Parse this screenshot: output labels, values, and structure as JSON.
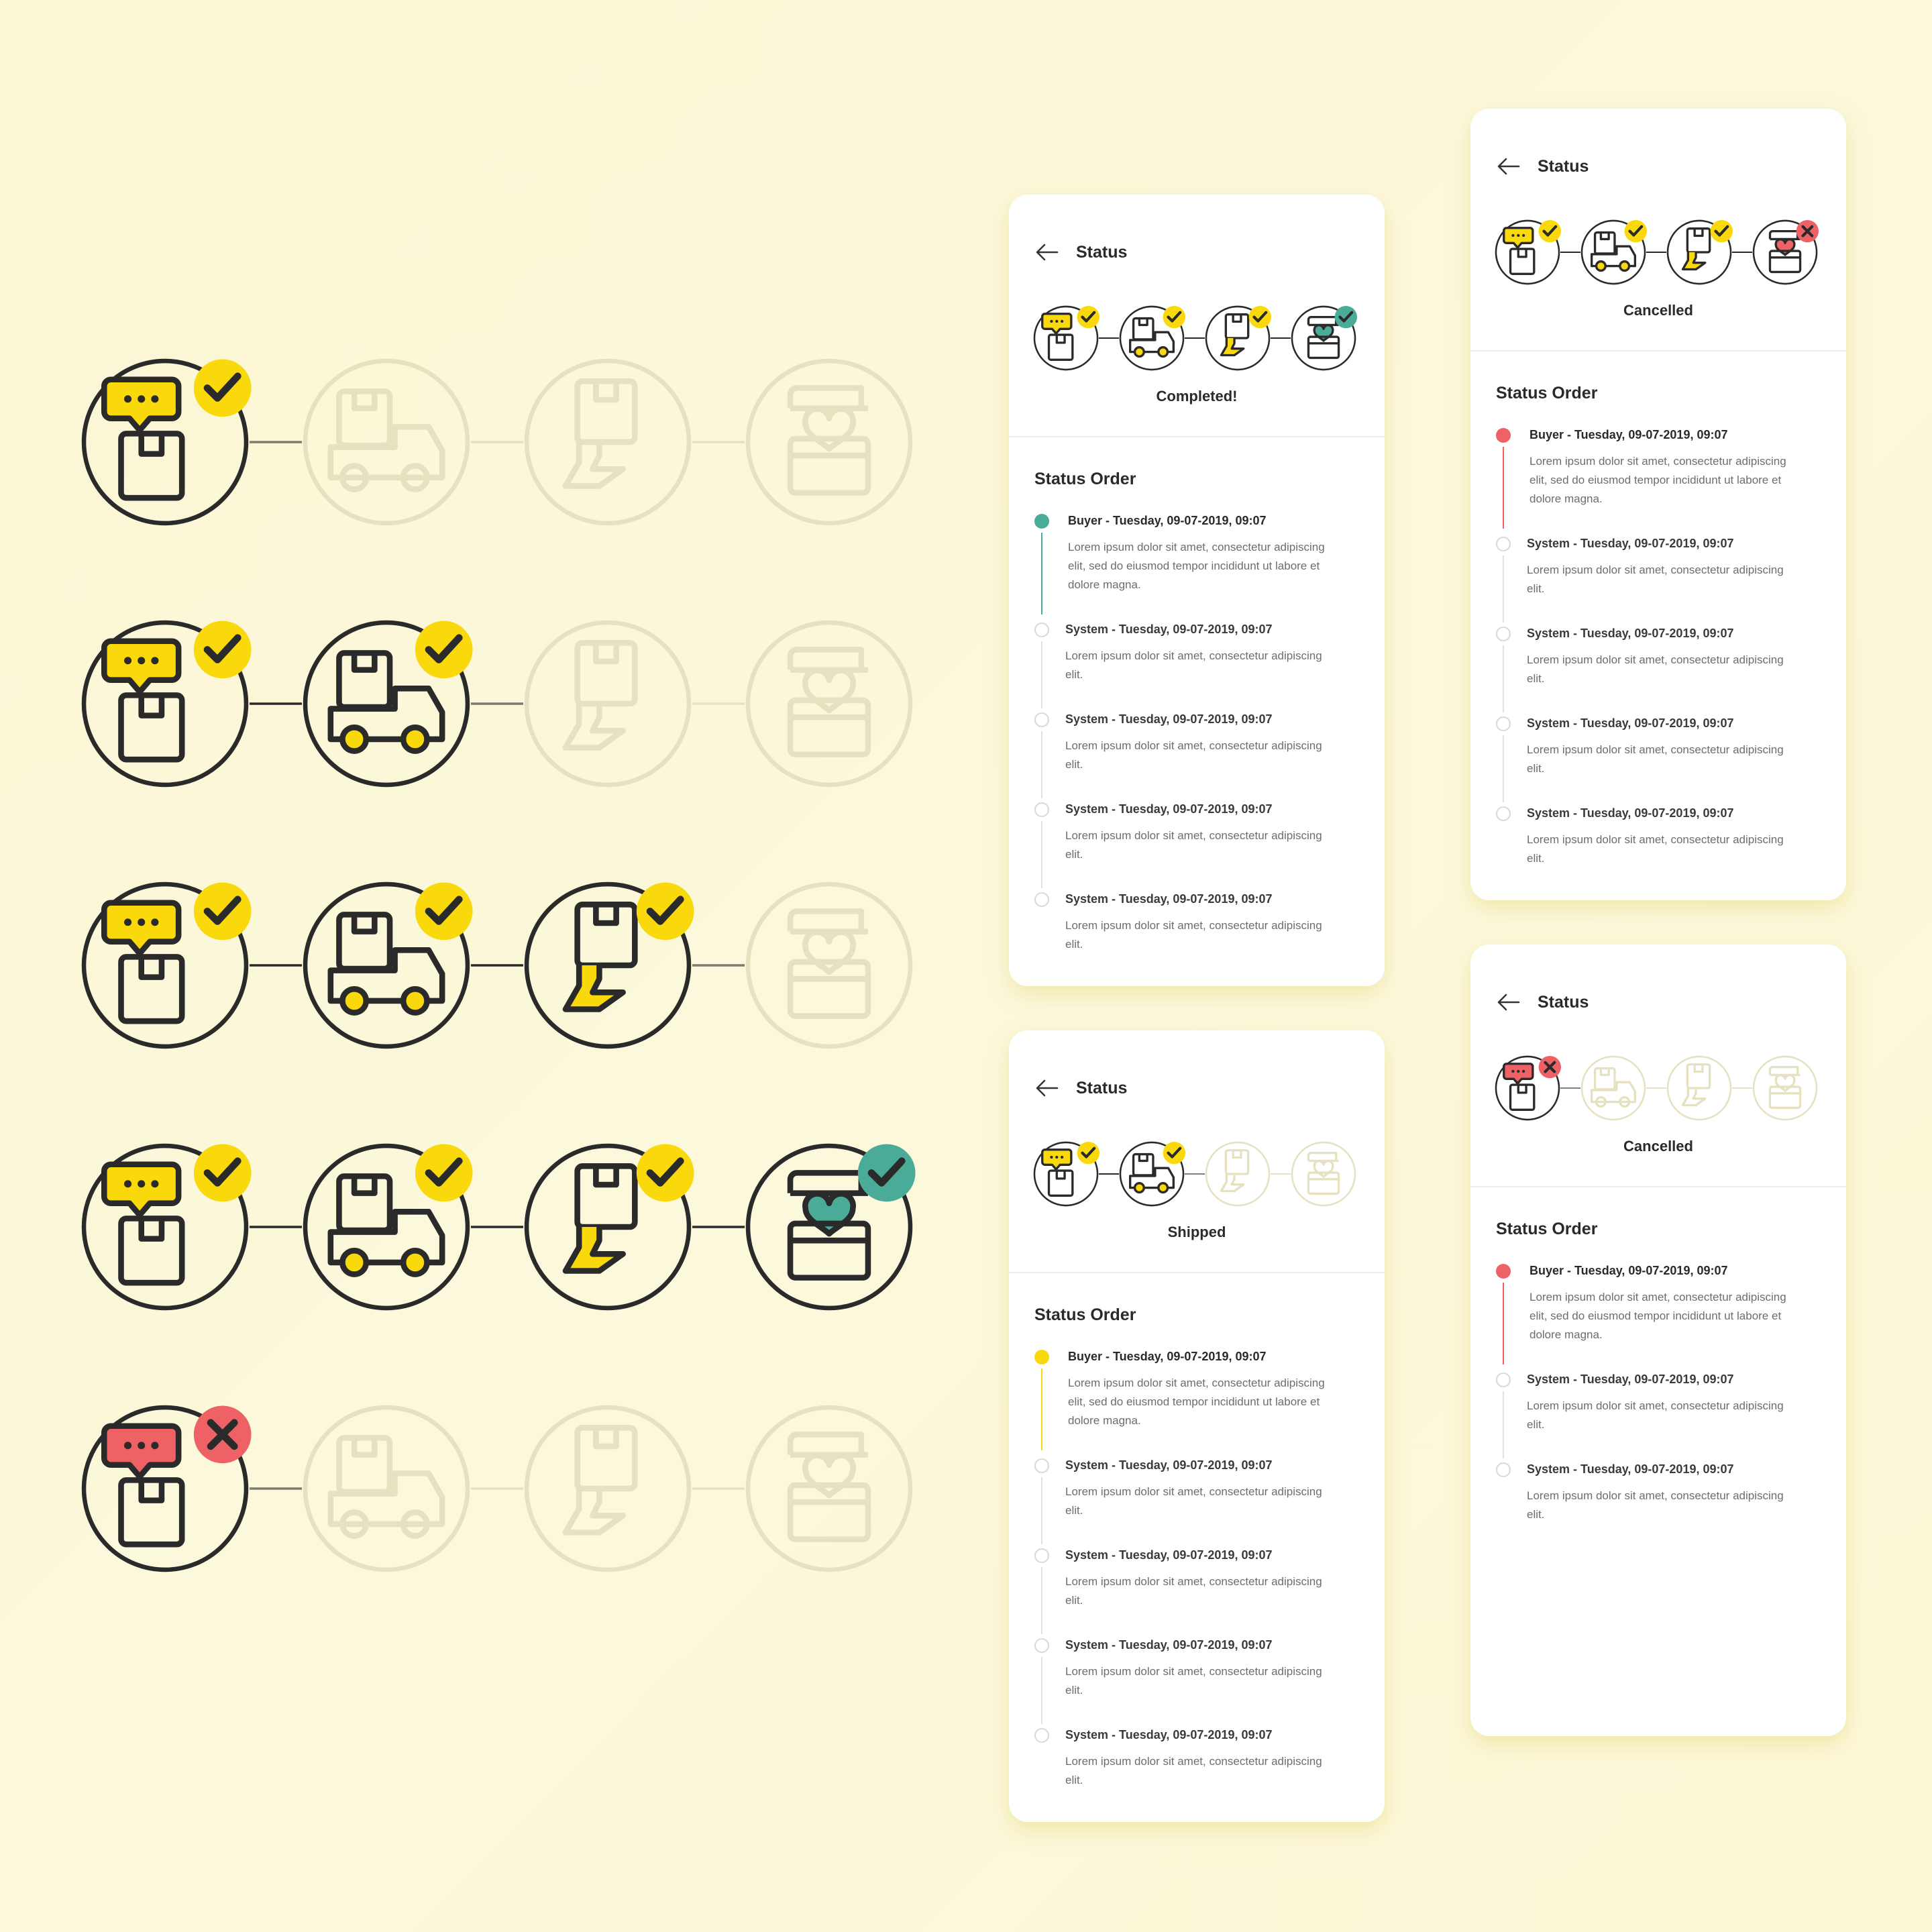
{
  "colors": {
    "yellow": "#f9d90c",
    "teal": "#4aab98",
    "red": "#ee6164",
    "ink": "#2a2a2a",
    "faded": "#e6e1c1"
  },
  "icons": [
    "chat-box-icon",
    "delivery-truck-icon",
    "hand-package-icon",
    "gift-box-icon"
  ],
  "big_rows": [
    {
      "steps": [
        "done",
        "inactive",
        "inactive",
        "inactive"
      ]
    },
    {
      "steps": [
        "done",
        "done",
        "inactive",
        "inactive"
      ]
    },
    {
      "steps": [
        "done",
        "done",
        "done",
        "inactive"
      ]
    },
    {
      "steps": [
        "done",
        "done",
        "done",
        "complete"
      ]
    },
    {
      "steps": [
        "cancel",
        "inactive",
        "inactive",
        "inactive"
      ]
    }
  ],
  "cards": [
    {
      "header_title": "Status",
      "state_label": "Completed!",
      "steps": [
        "done",
        "done",
        "done",
        "complete"
      ],
      "section_title": "Status Order",
      "first_dot": "teal",
      "items": [
        {
          "title": "Buyer - Tuesday, 09-07-2019, 09:07",
          "body": "Lorem ipsum dolor sit amet, consectetur adipiscing elit, sed do eiusmod tempor incididunt ut labore et dolore magna."
        },
        {
          "title": "System - Tuesday, 09-07-2019, 09:07",
          "body": "Lorem ipsum dolor sit amet, consectetur adipiscing elit."
        },
        {
          "title": "System - Tuesday, 09-07-2019, 09:07",
          "body": "Lorem ipsum dolor sit amet, consectetur adipiscing elit."
        },
        {
          "title": "System - Tuesday, 09-07-2019, 09:07",
          "body": "Lorem ipsum dolor sit amet, consectetur adipiscing elit."
        },
        {
          "title": "System - Tuesday, 09-07-2019, 09:07",
          "body": "Lorem ipsum dolor sit amet, consectetur adipiscing elit."
        }
      ]
    },
    {
      "header_title": "Status",
      "state_label": "Shipped",
      "steps": [
        "done",
        "done",
        "inactive",
        "inactive"
      ],
      "section_title": "Status Order",
      "first_dot": "yellow",
      "items": [
        {
          "title": "Buyer - Tuesday, 09-07-2019, 09:07",
          "body": "Lorem ipsum dolor sit amet, consectetur adipiscing elit, sed do eiusmod tempor incididunt ut labore et dolore magna."
        },
        {
          "title": "System - Tuesday, 09-07-2019, 09:07",
          "body": "Lorem ipsum dolor sit amet, consectetur adipiscing elit."
        },
        {
          "title": "System - Tuesday, 09-07-2019, 09:07",
          "body": "Lorem ipsum dolor sit amet, consectetur adipiscing elit."
        },
        {
          "title": "System - Tuesday, 09-07-2019, 09:07",
          "body": "Lorem ipsum dolor sit amet, consectetur adipiscing elit."
        },
        {
          "title": "System - Tuesday, 09-07-2019, 09:07",
          "body": "Lorem ipsum dolor sit amet, consectetur adipiscing elit."
        }
      ]
    },
    {
      "header_title": "Status",
      "state_label": "Cancelled",
      "steps": [
        "done",
        "done",
        "done",
        "cancel"
      ],
      "section_title": "Status Order",
      "first_dot": "red",
      "items": [
        {
          "title": "Buyer - Tuesday, 09-07-2019, 09:07",
          "body": "Lorem ipsum dolor sit amet, consectetur adipiscing elit, sed do eiusmod tempor incididunt ut labore et dolore magna."
        },
        {
          "title": "System - Tuesday, 09-07-2019, 09:07",
          "body": "Lorem ipsum dolor sit amet, consectetur adipiscing elit."
        },
        {
          "title": "System - Tuesday, 09-07-2019, 09:07",
          "body": "Lorem ipsum dolor sit amet, consectetur adipiscing elit."
        },
        {
          "title": "System - Tuesday, 09-07-2019, 09:07",
          "body": "Lorem ipsum dolor sit amet, consectetur adipiscing elit."
        },
        {
          "title": "System - Tuesday, 09-07-2019, 09:07",
          "body": "Lorem ipsum dolor sit amet, consectetur adipiscing elit."
        }
      ]
    },
    {
      "header_title": "Status",
      "state_label": "Cancelled",
      "steps": [
        "cancel",
        "inactive",
        "inactive",
        "inactive"
      ],
      "section_title": "Status Order",
      "first_dot": "red",
      "items": [
        {
          "title": "Buyer - Tuesday, 09-07-2019, 09:07",
          "body": "Lorem ipsum dolor sit amet, consectetur adipiscing elit, sed do eiusmod tempor incididunt ut labore et dolore magna."
        },
        {
          "title": "System - Tuesday, 09-07-2019, 09:07",
          "body": "Lorem ipsum dolor sit amet, consectetur adipiscing elit."
        },
        {
          "title": "System - Tuesday, 09-07-2019, 09:07",
          "body": "Lorem ipsum dolor sit amet, consectetur adipiscing elit."
        }
      ]
    }
  ]
}
